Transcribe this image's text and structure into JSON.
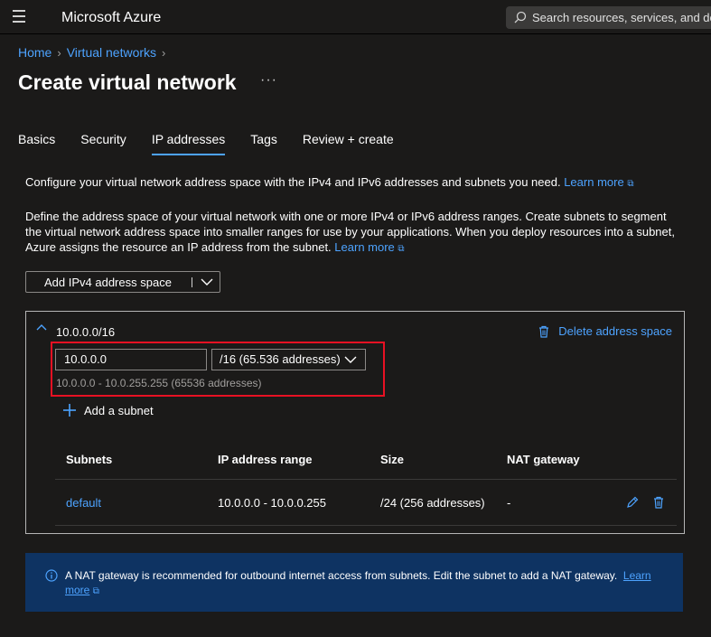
{
  "topbar": {
    "brand": "Microsoft Azure",
    "search_placeholder": "Search resources, services, and do"
  },
  "breadcrumb": {
    "items": [
      "Home",
      "Virtual networks"
    ]
  },
  "page": {
    "title": "Create virtual network",
    "more": "···"
  },
  "tabs": [
    "Basics",
    "Security",
    "IP addresses",
    "Tags",
    "Review + create"
  ],
  "active_tab": "IP addresses",
  "intro": {
    "text": "Configure your virtual network address space with the IPv4 and IPv6 addresses and subnets you need.",
    "link": "Learn more"
  },
  "description": {
    "text": "Define the address space of your virtual network with one or more IPv4 or IPv6 address ranges. Create subnets to segment the virtual network address space into smaller ranges for use by your applications. When you deploy resources into a subnet, Azure assigns the resource an IP address from the subnet.",
    "link": "Learn more"
  },
  "add_space_button": "Add IPv4 address space",
  "address_space": {
    "title": "10.0.0.0/16",
    "delete_label": "Delete address space",
    "address_value": "10.0.0.0",
    "prefix_value": "/16 (65.536 addresses)",
    "range_hint": "10.0.0.0 - 10.0.255.255 (65536 addresses)",
    "add_subnet": "Add a subnet"
  },
  "subnets_table": {
    "headers": [
      "Subnets",
      "IP address range",
      "Size",
      "NAT gateway"
    ],
    "rows": [
      {
        "name": "default",
        "range": "10.0.0.0 - 10.0.0.255",
        "size": "/24 (256 addresses)",
        "nat": "-"
      }
    ]
  },
  "banner": {
    "text": "A NAT gateway is recommended for outbound internet access from subnets. Edit the subnet to add a NAT gateway.",
    "link": "Learn more"
  },
  "colors": {
    "accent": "#4da3ff",
    "highlight": "#e81123",
    "banner_bg": "#0e3362"
  }
}
